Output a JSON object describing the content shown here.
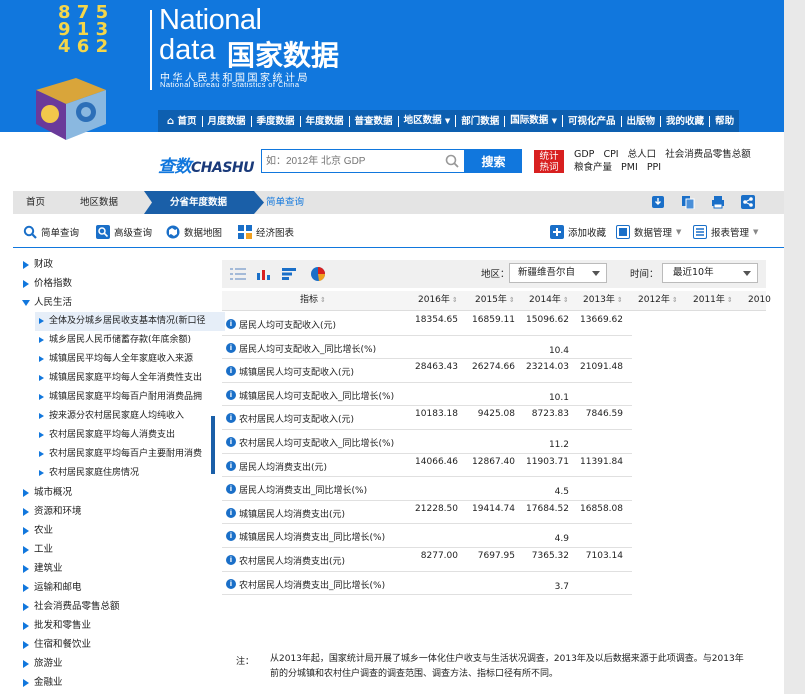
{
  "brand": {
    "en_line1": "National",
    "en_line2": "data",
    "cn_title": "国家数据",
    "cn_org": "中华人民共和国国家统计局",
    "en_org": "National Bureau of Statistics of China",
    "cube_digits": "8 7 5 9 1 3 4 6 2"
  },
  "nav": {
    "items": [
      "首页",
      "月度数据",
      "季度数据",
      "年度数据",
      "普查数据",
      "地区数据",
      "部门数据",
      "国际数据",
      "可视化产品",
      "出版物",
      "我的收藏",
      "帮助"
    ]
  },
  "search": {
    "logo_cn": "查数",
    "logo_en": "CHASHU",
    "placeholder": "如：2012年 北京 GDP",
    "button": "搜索",
    "hot_label_1": "统计",
    "hot_label_2": "热词",
    "hot_words": [
      "GDP",
      "CPI",
      "总人口",
      "社会消费品零售总额",
      "粮食产量",
      "PMI",
      "PPI"
    ]
  },
  "breadcrumb": {
    "home": "首页",
    "region": "地区数据",
    "active": "分省年度数据",
    "simple": "简单查询"
  },
  "tools": {
    "simple_query": "简单查询",
    "advanced_query": "高级查询",
    "data_map": "数据地图",
    "economic_chart": "经济图表",
    "add_favorite": "添加收藏",
    "data_manage": "数据管理",
    "report_manage": "报表管理"
  },
  "sidebar": {
    "top_items": [
      "财政",
      "价格指数"
    ],
    "expanded": "人民生活",
    "sub_items": [
      "全体及分城乡居民收支基本情况(新口径",
      "城乡居民人民币储蓄存款(年底余额)",
      "城镇居民平均每人全年家庭收入来源",
      "城镇居民家庭平均每人全年消费性支出",
      "城镇居民家庭平均每百户耐用消费品拥",
      "按来源分农村居民家庭人均纯收入",
      "农村居民家庭平均每人消费支出",
      "农村居民家庭平均每百户主要耐用消费",
      "农村居民家庭住房情况"
    ],
    "bottom_items": [
      "城市概况",
      "资源和环境",
      "农业",
      "工业",
      "建筑业",
      "运输和邮电",
      "社会消费品零售总额",
      "批发和零售业",
      "住宿和餐饮业",
      "旅游业",
      "金融业"
    ]
  },
  "filter": {
    "region_label": "地区：",
    "region_value": "新疆维吾尔自",
    "time_label": "时间：",
    "time_value": "最近10年"
  },
  "table": {
    "indicator_header": "指标",
    "years": [
      "2016年",
      "2015年",
      "2014年",
      "2013年",
      "2012年",
      "2011年",
      "2010"
    ],
    "rows": [
      {
        "name": "居民人均可支配收入(元)",
        "values": [
          "18354.65",
          "16859.11",
          "15096.62",
          "13669.62"
        ]
      },
      {
        "name": "居民人均可支配收入_同比增长(%)",
        "values": [
          "",
          "",
          "10.4",
          ""
        ]
      },
      {
        "name": "城镇居民人均可支配收入(元)",
        "values": [
          "28463.43",
          "26274.66",
          "23214.03",
          "21091.48"
        ]
      },
      {
        "name": "城镇居民人均可支配收入_同比增长(%)",
        "values": [
          "",
          "",
          "10.1",
          ""
        ]
      },
      {
        "name": "农村居民人均可支配收入(元)",
        "values": [
          "10183.18",
          "9425.08",
          "8723.83",
          "7846.59"
        ]
      },
      {
        "name": "农村居民人均可支配收入_同比增长(%)",
        "values": [
          "",
          "",
          "11.2",
          ""
        ]
      },
      {
        "name": "居民人均消费支出(元)",
        "values": [
          "14066.46",
          "12867.40",
          "11903.71",
          "11391.84"
        ]
      },
      {
        "name": "居民人均消费支出_同比增长(%)",
        "values": [
          "",
          "",
          "4.5",
          ""
        ]
      },
      {
        "name": "城镇居民人均消费支出(元)",
        "values": [
          "21228.50",
          "19414.74",
          "17684.52",
          "16858.08"
        ]
      },
      {
        "name": "城镇居民人均消费支出_同比增长(%)",
        "values": [
          "",
          "",
          "4.9",
          ""
        ]
      },
      {
        "name": "农村居民人均消费支出(元)",
        "values": [
          "8277.00",
          "7697.95",
          "7365.32",
          "7103.14"
        ]
      },
      {
        "name": "农村居民人均消费支出_同比增长(%)",
        "values": [
          "",
          "",
          "3.7",
          ""
        ]
      }
    ]
  },
  "note": {
    "label": "注：",
    "text": "从2013年起，国家统计局开展了城乡一体化住户收支与生活状况调查，2013年及以后数据来源于此项调查。与2013年前的分城镇和农村住户调查的调查范围、调查方法、指标口径有所不同。"
  }
}
